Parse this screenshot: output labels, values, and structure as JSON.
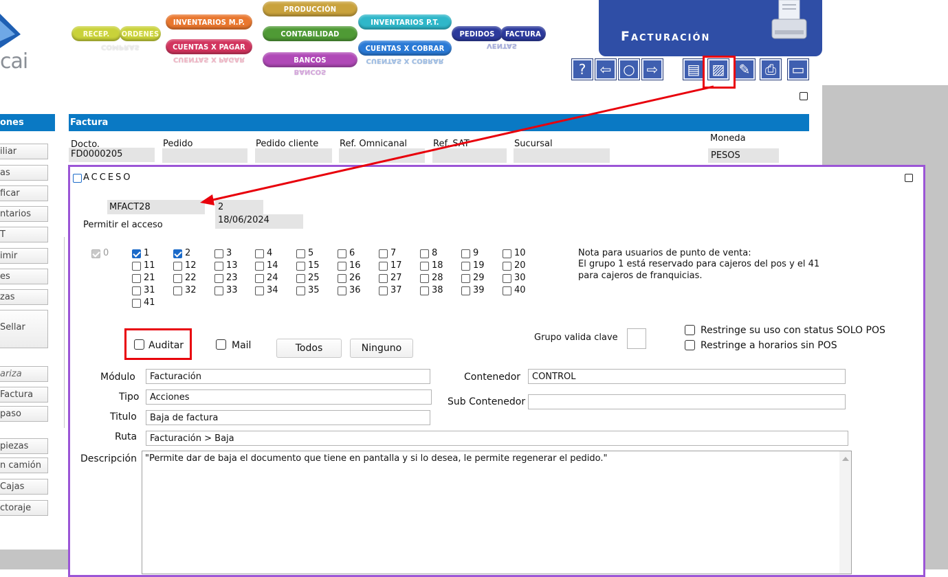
{
  "logo": {
    "text": "cai"
  },
  "nav": {
    "recep": "RECEP.",
    "ordenes": "ORDENES",
    "compras_reflection": "COMPRAS",
    "inventarios_mp": "INVENTARIOS M.P.",
    "cuentas_pagar": "CUENTAS X PAGAR",
    "cuentas_pagar_reflection": "CUENTAS X PAGAR",
    "produccion": "PRODUCCIÓN",
    "contabilidad": "CONTABILIDAD",
    "bancos": "BANCOS",
    "bancos_reflection": "BANCOS",
    "inventarios_pt": "INVENTARIOS P.T.",
    "cuentas_cobrar": "CUENTAS X COBRAR",
    "cuentas_cobrar_reflection": "CUENTAS X COBRAR",
    "pedidos": "PEDIDOS",
    "factura": "FACTURA",
    "ventas_reflection": "VENTAS"
  },
  "module_banner": {
    "title": "Facturación"
  },
  "toolbar": {
    "help": "?",
    "prev": "⇦",
    "search": "○",
    "next": "⇨",
    "list": "▤",
    "access": "▨",
    "edit": "✎",
    "print": "⎙",
    "window": "▭"
  },
  "sidebar": {
    "header": "ones",
    "items": [
      "iliar",
      "as",
      "ficar",
      "ntarios",
      "T",
      "imir",
      "es",
      "zas",
      "Sellar",
      "ariza",
      "Factura",
      "paso",
      "piezas",
      "n camión",
      "Cajas",
      "ctoraje"
    ]
  },
  "factura": {
    "header": "Factura",
    "docto_label": "Docto.",
    "docto_value": "FD0000205",
    "pedido_label": "Pedido",
    "pedido_cliente_label": "Pedido cliente",
    "ref_omnicanal_label": "Ref. Omnicanal",
    "ref_sat_label": "Ref. SAT",
    "sucursal_label": "Sucursal",
    "moneda_label": "Moneda",
    "moneda_value": "PESOS"
  },
  "acceso": {
    "title": "ACCESO",
    "code": "MFACT28",
    "number": "2",
    "date": "18/06/2024",
    "permitir_label": "Permitir el acceso",
    "groups": [
      {
        "n": "0",
        "checked": true,
        "disabled": true
      },
      {
        "n": "1",
        "checked": true
      },
      {
        "n": "2",
        "checked": true
      },
      {
        "n": "3"
      },
      {
        "n": "4"
      },
      {
        "n": "5"
      },
      {
        "n": "6"
      },
      {
        "n": "7"
      },
      {
        "n": "8"
      },
      {
        "n": "9"
      },
      {
        "n": "10"
      },
      {
        "n": "11"
      },
      {
        "n": "12"
      },
      {
        "n": "13"
      },
      {
        "n": "14"
      },
      {
        "n": "15"
      },
      {
        "n": "16"
      },
      {
        "n": "17"
      },
      {
        "n": "18"
      },
      {
        "n": "19"
      },
      {
        "n": "20"
      },
      {
        "n": "21"
      },
      {
        "n": "22"
      },
      {
        "n": "23"
      },
      {
        "n": "24"
      },
      {
        "n": "25"
      },
      {
        "n": "26"
      },
      {
        "n": "27"
      },
      {
        "n": "28"
      },
      {
        "n": "29"
      },
      {
        "n": "30"
      },
      {
        "n": "31"
      },
      {
        "n": "32"
      },
      {
        "n": "33"
      },
      {
        "n": "34"
      },
      {
        "n": "35"
      },
      {
        "n": "36"
      },
      {
        "n": "37"
      },
      {
        "n": "38"
      },
      {
        "n": "39"
      },
      {
        "n": "40"
      },
      {
        "n": "41"
      }
    ],
    "note_line1": "Nota para usuarios de punto de venta:",
    "note_line2": "El grupo 1 está reservado para cajeros del pos y el 41",
    "note_line3": "para cajeros de franquicias.",
    "auditar_label": "Auditar",
    "mail_label": "Mail",
    "todos_label": "Todos",
    "ninguno_label": "Ninguno",
    "grupo_valida_label": "Grupo valida clave",
    "restringe_status_label": "Restringe su uso con status  SOLO POS",
    "restringe_horarios_label": "Restringe a horarios sin POS",
    "modulo_label": "Módulo",
    "modulo_value": "Facturación",
    "tipo_label": "Tipo",
    "tipo_value": "Acciones",
    "titulo_label": "Titulo",
    "titulo_value": "Baja de factura",
    "ruta_label": "Ruta",
    "ruta_value": "Facturación > Baja",
    "contenedor_label": "Contenedor",
    "contenedor_value": "CONTROL",
    "sub_contenedor_label": "Sub Contenedor",
    "sub_contenedor_value": "",
    "descripcion_label": "Descripción",
    "descripcion_value": "\"Permite dar de baja el documento que tiene en pantalla y si lo desea, le permite regenerar el pedido.\""
  },
  "colors": {
    "section_header": "#0a79c4",
    "panel_border": "#9b55d6",
    "highlight": "#e8000b",
    "banner": "#2f4ea6"
  }
}
